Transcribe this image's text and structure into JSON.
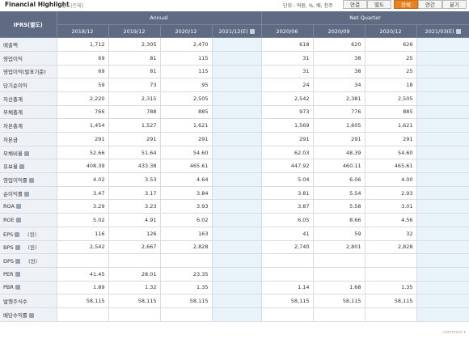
{
  "header": {
    "title": "Financial Highlight",
    "subtitle": "[별도|전체]",
    "unit": "단위 : 억원, %, 배, 천주",
    "buttons": [
      {
        "label": "연결",
        "active": false
      },
      {
        "label": "별도",
        "active": false
      },
      {
        "label": "전체",
        "active": true
      },
      {
        "label": "연간",
        "active": false
      },
      {
        "label": "분기",
        "active": false
      }
    ]
  },
  "table": {
    "corner_label": "IFRS(별도)",
    "group_annual": "Annual",
    "group_quarter": "Net Quarter",
    "annual_cols": [
      "2018/12",
      "2019/12",
      "2020/12",
      "2021/12(E)"
    ],
    "quarter_cols": [
      "2020/06",
      "2020/09",
      "2020/12",
      "2021/03(E)"
    ],
    "rows": [
      {
        "label": "매출액",
        "info": false,
        "unit": "",
        "annual": [
          "1,712",
          "2,305",
          "2,470",
          ""
        ],
        "quarter": [
          "618",
          "620",
          "626",
          ""
        ]
      },
      {
        "label": "영업이익",
        "info": false,
        "unit": "",
        "annual": [
          "69",
          "81",
          "115",
          ""
        ],
        "quarter": [
          "31",
          "38",
          "25",
          ""
        ]
      },
      {
        "label": "영업이익(발표기준)",
        "info": false,
        "unit": "",
        "annual": [
          "69",
          "81",
          "115",
          ""
        ],
        "quarter": [
          "31",
          "38",
          "25",
          ""
        ]
      },
      {
        "label": "당기순이익",
        "info": false,
        "unit": "",
        "annual": [
          "59",
          "73",
          "95",
          ""
        ],
        "quarter": [
          "24",
          "34",
          "18",
          ""
        ]
      },
      {
        "label": "자산총계",
        "info": false,
        "unit": "",
        "annual": [
          "2,220",
          "2,315",
          "2,505",
          ""
        ],
        "quarter": [
          "2,542",
          "2,381",
          "2,505",
          ""
        ]
      },
      {
        "label": "부채총계",
        "info": false,
        "unit": "",
        "annual": [
          "766",
          "788",
          "885",
          ""
        ],
        "quarter": [
          "973",
          "776",
          "885",
          ""
        ]
      },
      {
        "label": "자본총계",
        "info": false,
        "unit": "",
        "annual": [
          "1,454",
          "1,527",
          "1,621",
          ""
        ],
        "quarter": [
          "1,569",
          "1,605",
          "1,621",
          ""
        ]
      },
      {
        "label": "자본금",
        "info": false,
        "unit": "",
        "annual": [
          "291",
          "291",
          "291",
          ""
        ],
        "quarter": [
          "291",
          "291",
          "291",
          ""
        ]
      },
      {
        "label": "부채비율",
        "info": true,
        "unit": "",
        "annual": [
          "52.66",
          "51.64",
          "54.60",
          ""
        ],
        "quarter": [
          "62.03",
          "48.39",
          "54.60",
          ""
        ]
      },
      {
        "label": "유보율",
        "info": true,
        "unit": "",
        "annual": [
          "408.39",
          "433.38",
          "465.61",
          ""
        ],
        "quarter": [
          "447.92",
          "460.11",
          "465.61",
          ""
        ]
      },
      {
        "label": "영업이익률",
        "info": true,
        "unit": "",
        "annual": [
          "4.02",
          "3.53",
          "4.64",
          ""
        ],
        "quarter": [
          "5.04",
          "6.06",
          "4.00",
          ""
        ]
      },
      {
        "label": "순이익률",
        "info": true,
        "unit": "",
        "annual": [
          "3.47",
          "3.17",
          "3.84",
          ""
        ],
        "quarter": [
          "3.81",
          "5.54",
          "2.93",
          ""
        ]
      },
      {
        "label": "ROA",
        "info": true,
        "unit": "",
        "annual": [
          "3.29",
          "3.23",
          "3.93",
          ""
        ],
        "quarter": [
          "3.87",
          "5.58",
          "3.01",
          ""
        ]
      },
      {
        "label": "ROE",
        "info": true,
        "unit": "",
        "annual": [
          "5.02",
          "4.91",
          "6.02",
          ""
        ],
        "quarter": [
          "6.05",
          "8.66",
          "4.56",
          ""
        ]
      },
      {
        "label": "EPS",
        "info": true,
        "unit": "(원)",
        "annual": [
          "116",
          "126",
          "163",
          ""
        ],
        "quarter": [
          "41",
          "59",
          "32",
          ""
        ]
      },
      {
        "label": "BPS",
        "info": true,
        "unit": "(원)",
        "annual": [
          "2,542",
          "2,667",
          "2,828",
          ""
        ],
        "quarter": [
          "2,740",
          "2,801",
          "2,828",
          ""
        ]
      },
      {
        "label": "DPS",
        "info": true,
        "unit": "(원)",
        "annual": [
          "",
          "",
          "",
          ""
        ],
        "quarter": [
          "",
          "",
          "",
          ""
        ]
      },
      {
        "label": "PER",
        "info": true,
        "unit": "",
        "annual": [
          "41.45",
          "28.01",
          "23.35",
          ""
        ],
        "quarter": [
          "",
          "",
          "",
          ""
        ]
      },
      {
        "label": "PBR",
        "info": true,
        "unit": "",
        "annual": [
          "1.89",
          "1.32",
          "1.35",
          ""
        ],
        "quarter": [
          "1.14",
          "1.68",
          "1.35",
          ""
        ]
      },
      {
        "label": "발행주식수",
        "info": false,
        "unit": "",
        "annual": [
          "58,115",
          "58,115",
          "58,115",
          ""
        ],
        "quarter": [
          "58,115",
          "58,115",
          "58,115",
          ""
        ]
      },
      {
        "label": "배당수익률",
        "info": true,
        "unit": "",
        "annual": [
          "",
          "",
          "",
          ""
        ],
        "quarter": [
          "",
          "",
          "",
          ""
        ]
      }
    ]
  },
  "footer": {
    "text": "comment ▾"
  },
  "colors": {
    "header_bg": "#5e6b82",
    "label_bg": "#eef1f6",
    "estimate_bg": "#e8f3fa",
    "active_button": "#e58322"
  }
}
